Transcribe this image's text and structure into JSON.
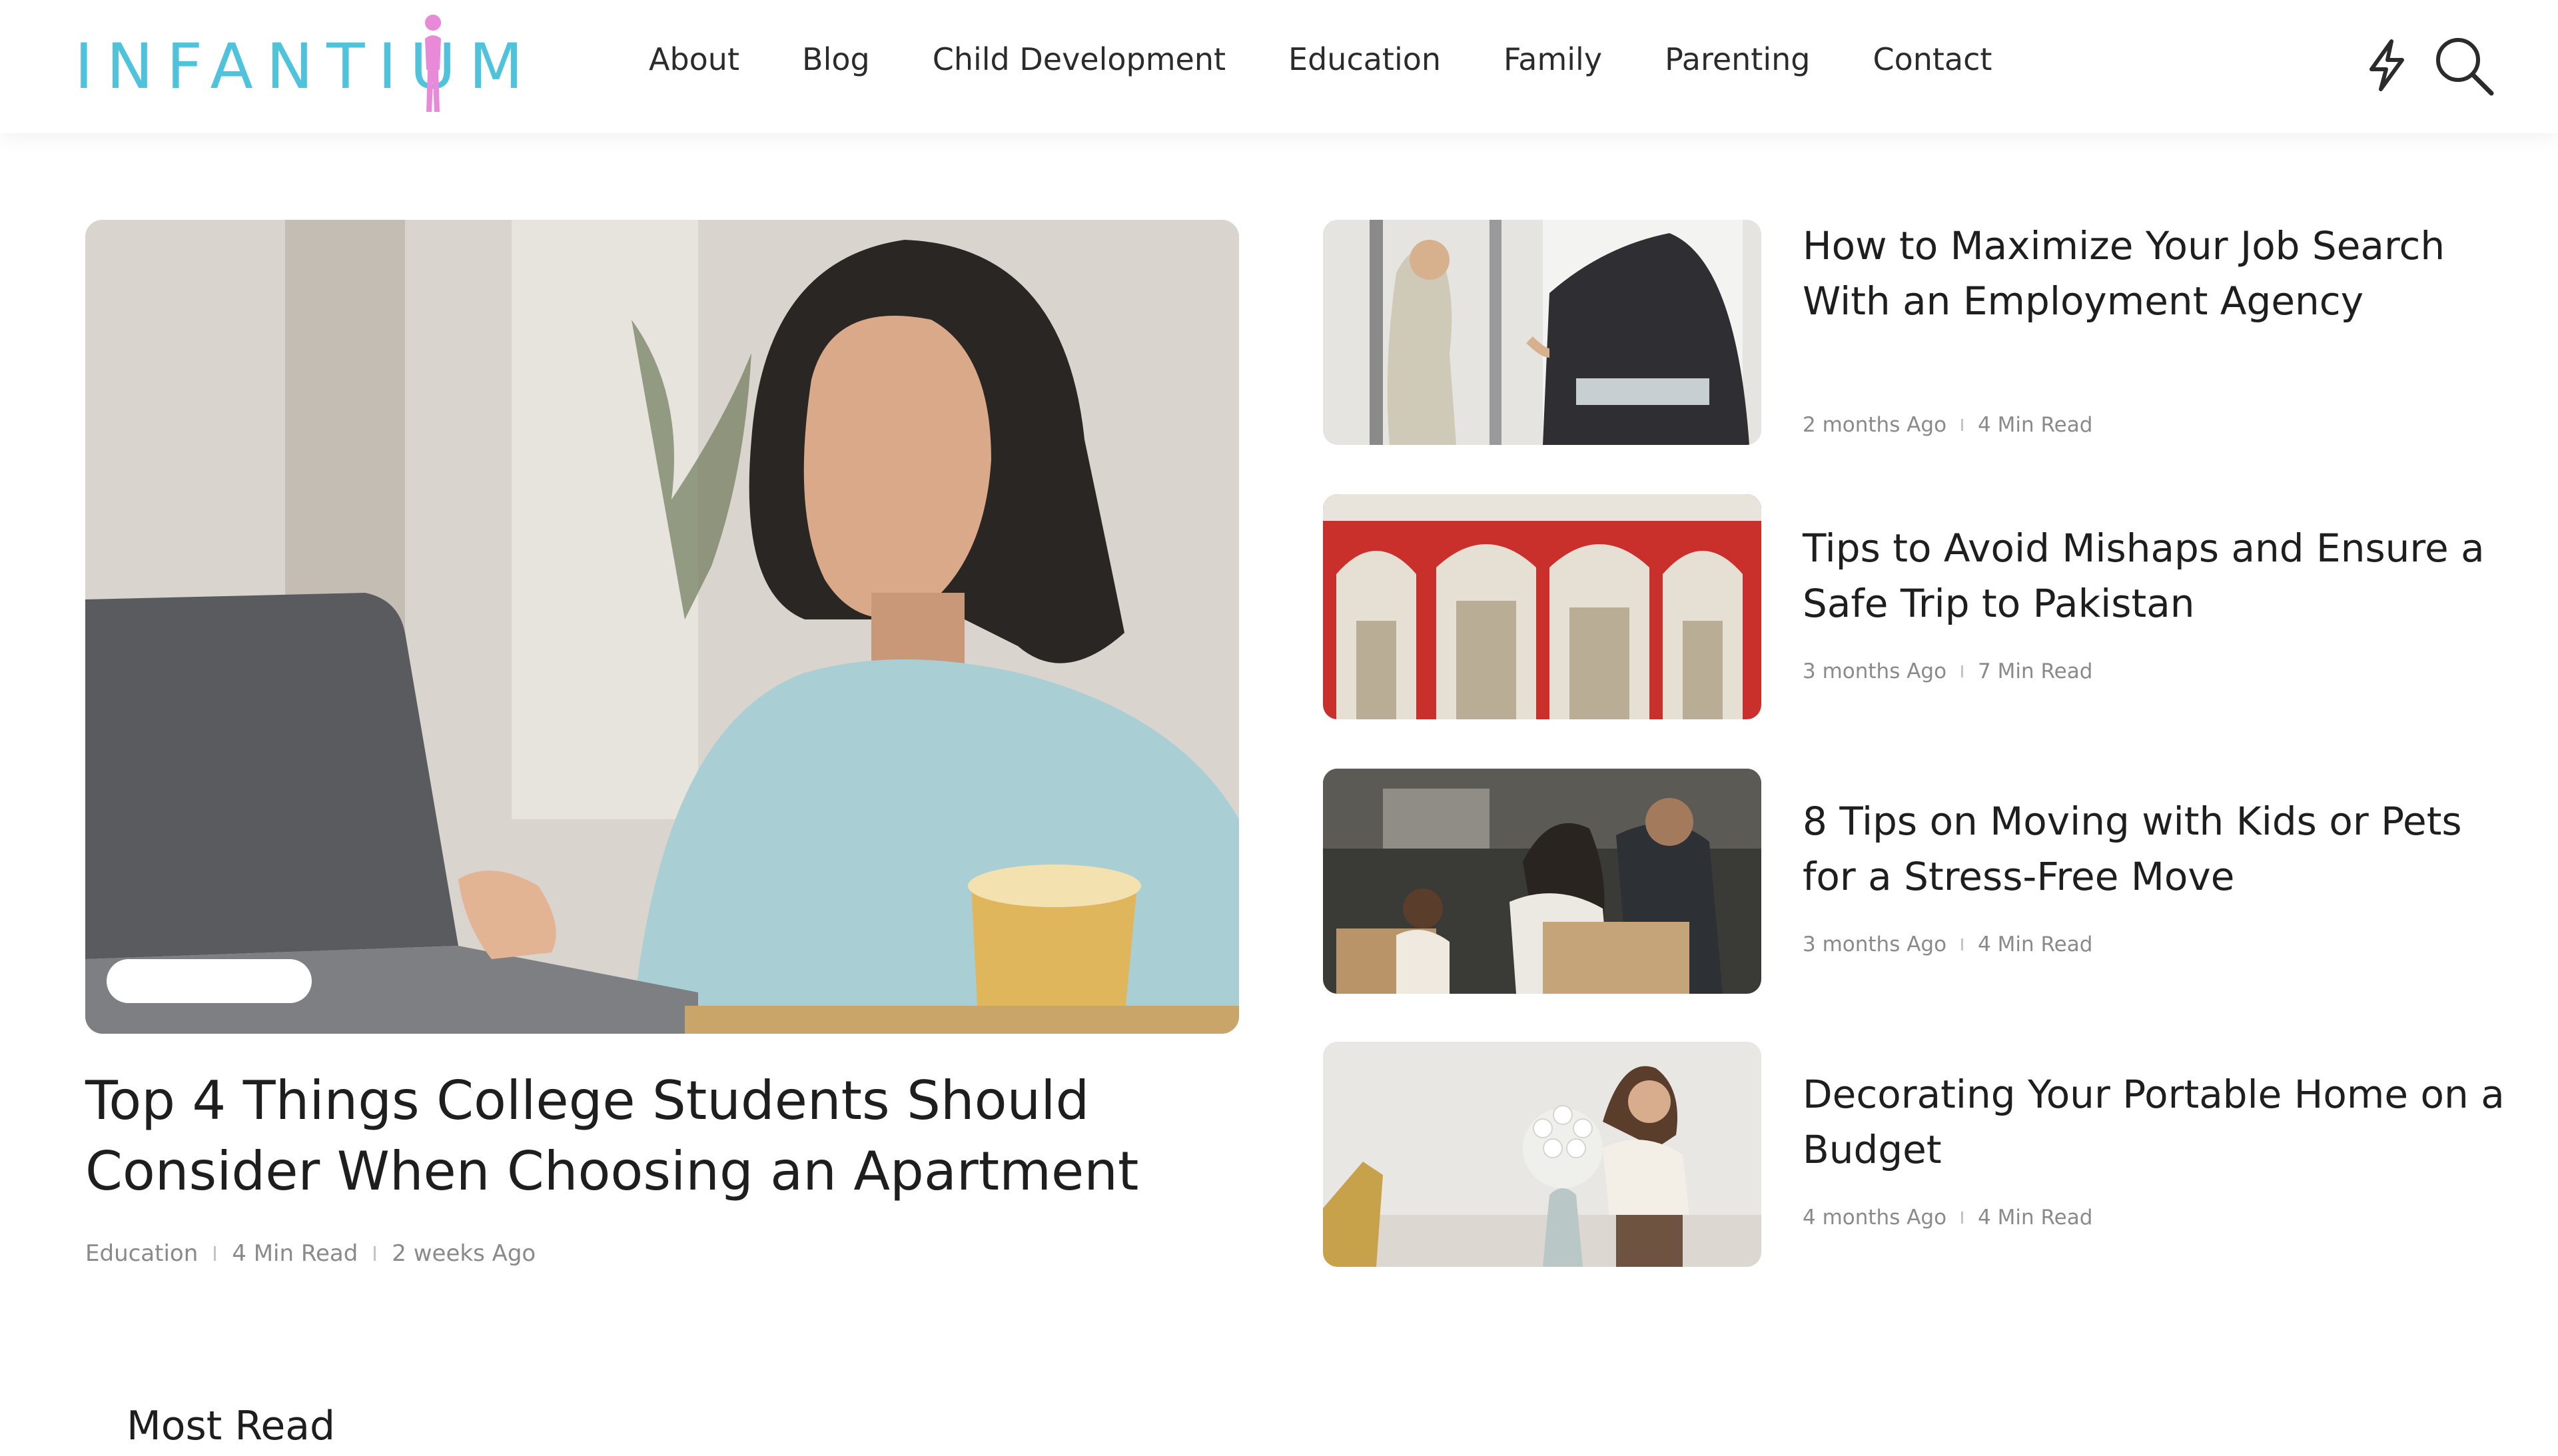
{
  "header": {
    "logo_text": "INFANTIUM",
    "nav": [
      "About",
      "Blog",
      "Child Development",
      "Education",
      "Family",
      "Parenting",
      "Contact"
    ],
    "icons": [
      "bolt-icon",
      "search-icon"
    ]
  },
  "featured": {
    "title": "Top 4 Things College Students Should Consider When Choosing an Apartment",
    "category": "Education",
    "read_time": "4 Min Read",
    "date": "2 weeks Ago"
  },
  "posts": [
    {
      "title": "How to Maximize Your Job Search With an Employment Agency",
      "date": "2 months Ago",
      "read_time": "4 Min Read"
    },
    {
      "title": "Tips to Avoid Mishaps and Ensure a Safe Trip to Pakistan",
      "date": "3 months Ago",
      "read_time": "7 Min Read"
    },
    {
      "title": "8 Tips on Moving with Kids or Pets for a Stress-Free Move",
      "date": "3 months Ago",
      "read_time": "4 Min Read"
    },
    {
      "title": "Decorating Your Portable Home on a Budget",
      "date": "4 months Ago",
      "read_time": "4 Min Read"
    }
  ],
  "sections": {
    "most_read": "Most Read"
  },
  "colors": {
    "brand": "#4fc3dc",
    "logo_accent": "#e98ad8",
    "text": "#1e1e1e",
    "meta": "#8a8a8a"
  }
}
